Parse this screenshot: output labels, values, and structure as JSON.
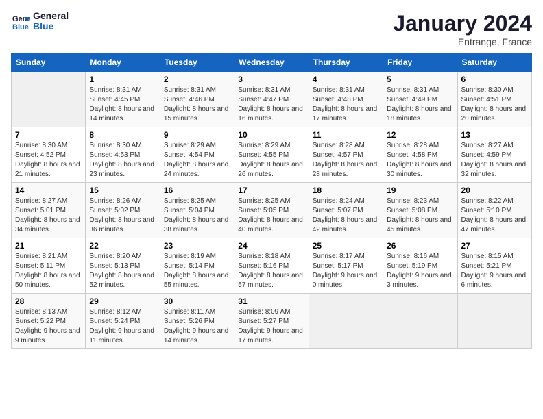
{
  "header": {
    "logo_line1": "General",
    "logo_line2": "Blue",
    "month": "January 2024",
    "location": "Entrange, France"
  },
  "weekdays": [
    "Sunday",
    "Monday",
    "Tuesday",
    "Wednesday",
    "Thursday",
    "Friday",
    "Saturday"
  ],
  "weeks": [
    [
      {
        "day": "",
        "sunrise": "",
        "sunset": "",
        "daylight": ""
      },
      {
        "day": "1",
        "sunrise": "Sunrise: 8:31 AM",
        "sunset": "Sunset: 4:45 PM",
        "daylight": "Daylight: 8 hours and 14 minutes."
      },
      {
        "day": "2",
        "sunrise": "Sunrise: 8:31 AM",
        "sunset": "Sunset: 4:46 PM",
        "daylight": "Daylight: 8 hours and 15 minutes."
      },
      {
        "day": "3",
        "sunrise": "Sunrise: 8:31 AM",
        "sunset": "Sunset: 4:47 PM",
        "daylight": "Daylight: 8 hours and 16 minutes."
      },
      {
        "day": "4",
        "sunrise": "Sunrise: 8:31 AM",
        "sunset": "Sunset: 4:48 PM",
        "daylight": "Daylight: 8 hours and 17 minutes."
      },
      {
        "day": "5",
        "sunrise": "Sunrise: 8:31 AM",
        "sunset": "Sunset: 4:49 PM",
        "daylight": "Daylight: 8 hours and 18 minutes."
      },
      {
        "day": "6",
        "sunrise": "Sunrise: 8:30 AM",
        "sunset": "Sunset: 4:51 PM",
        "daylight": "Daylight: 8 hours and 20 minutes."
      }
    ],
    [
      {
        "day": "7",
        "sunrise": "Sunrise: 8:30 AM",
        "sunset": "Sunset: 4:52 PM",
        "daylight": "Daylight: 8 hours and 21 minutes."
      },
      {
        "day": "8",
        "sunrise": "Sunrise: 8:30 AM",
        "sunset": "Sunset: 4:53 PM",
        "daylight": "Daylight: 8 hours and 23 minutes."
      },
      {
        "day": "9",
        "sunrise": "Sunrise: 8:29 AM",
        "sunset": "Sunset: 4:54 PM",
        "daylight": "Daylight: 8 hours and 24 minutes."
      },
      {
        "day": "10",
        "sunrise": "Sunrise: 8:29 AM",
        "sunset": "Sunset: 4:55 PM",
        "daylight": "Daylight: 8 hours and 26 minutes."
      },
      {
        "day": "11",
        "sunrise": "Sunrise: 8:28 AM",
        "sunset": "Sunset: 4:57 PM",
        "daylight": "Daylight: 8 hours and 28 minutes."
      },
      {
        "day": "12",
        "sunrise": "Sunrise: 8:28 AM",
        "sunset": "Sunset: 4:58 PM",
        "daylight": "Daylight: 8 hours and 30 minutes."
      },
      {
        "day": "13",
        "sunrise": "Sunrise: 8:27 AM",
        "sunset": "Sunset: 4:59 PM",
        "daylight": "Daylight: 8 hours and 32 minutes."
      }
    ],
    [
      {
        "day": "14",
        "sunrise": "Sunrise: 8:27 AM",
        "sunset": "Sunset: 5:01 PM",
        "daylight": "Daylight: 8 hours and 34 minutes."
      },
      {
        "day": "15",
        "sunrise": "Sunrise: 8:26 AM",
        "sunset": "Sunset: 5:02 PM",
        "daylight": "Daylight: 8 hours and 36 minutes."
      },
      {
        "day": "16",
        "sunrise": "Sunrise: 8:25 AM",
        "sunset": "Sunset: 5:04 PM",
        "daylight": "Daylight: 8 hours and 38 minutes."
      },
      {
        "day": "17",
        "sunrise": "Sunrise: 8:25 AM",
        "sunset": "Sunset: 5:05 PM",
        "daylight": "Daylight: 8 hours and 40 minutes."
      },
      {
        "day": "18",
        "sunrise": "Sunrise: 8:24 AM",
        "sunset": "Sunset: 5:07 PM",
        "daylight": "Daylight: 8 hours and 42 minutes."
      },
      {
        "day": "19",
        "sunrise": "Sunrise: 8:23 AM",
        "sunset": "Sunset: 5:08 PM",
        "daylight": "Daylight: 8 hours and 45 minutes."
      },
      {
        "day": "20",
        "sunrise": "Sunrise: 8:22 AM",
        "sunset": "Sunset: 5:10 PM",
        "daylight": "Daylight: 8 hours and 47 minutes."
      }
    ],
    [
      {
        "day": "21",
        "sunrise": "Sunrise: 8:21 AM",
        "sunset": "Sunset: 5:11 PM",
        "daylight": "Daylight: 8 hours and 50 minutes."
      },
      {
        "day": "22",
        "sunrise": "Sunrise: 8:20 AM",
        "sunset": "Sunset: 5:13 PM",
        "daylight": "Daylight: 8 hours and 52 minutes."
      },
      {
        "day": "23",
        "sunrise": "Sunrise: 8:19 AM",
        "sunset": "Sunset: 5:14 PM",
        "daylight": "Daylight: 8 hours and 55 minutes."
      },
      {
        "day": "24",
        "sunrise": "Sunrise: 8:18 AM",
        "sunset": "Sunset: 5:16 PM",
        "daylight": "Daylight: 8 hours and 57 minutes."
      },
      {
        "day": "25",
        "sunrise": "Sunrise: 8:17 AM",
        "sunset": "Sunset: 5:17 PM",
        "daylight": "Daylight: 9 hours and 0 minutes."
      },
      {
        "day": "26",
        "sunrise": "Sunrise: 8:16 AM",
        "sunset": "Sunset: 5:19 PM",
        "daylight": "Daylight: 9 hours and 3 minutes."
      },
      {
        "day": "27",
        "sunrise": "Sunrise: 8:15 AM",
        "sunset": "Sunset: 5:21 PM",
        "daylight": "Daylight: 9 hours and 6 minutes."
      }
    ],
    [
      {
        "day": "28",
        "sunrise": "Sunrise: 8:13 AM",
        "sunset": "Sunset: 5:22 PM",
        "daylight": "Daylight: 9 hours and 9 minutes."
      },
      {
        "day": "29",
        "sunrise": "Sunrise: 8:12 AM",
        "sunset": "Sunset: 5:24 PM",
        "daylight": "Daylight: 9 hours and 11 minutes."
      },
      {
        "day": "30",
        "sunrise": "Sunrise: 8:11 AM",
        "sunset": "Sunset: 5:26 PM",
        "daylight": "Daylight: 9 hours and 14 minutes."
      },
      {
        "day": "31",
        "sunrise": "Sunrise: 8:09 AM",
        "sunset": "Sunset: 5:27 PM",
        "daylight": "Daylight: 9 hours and 17 minutes."
      },
      {
        "day": "",
        "sunrise": "",
        "sunset": "",
        "daylight": ""
      },
      {
        "day": "",
        "sunrise": "",
        "sunset": "",
        "daylight": ""
      },
      {
        "day": "",
        "sunrise": "",
        "sunset": "",
        "daylight": ""
      }
    ]
  ]
}
